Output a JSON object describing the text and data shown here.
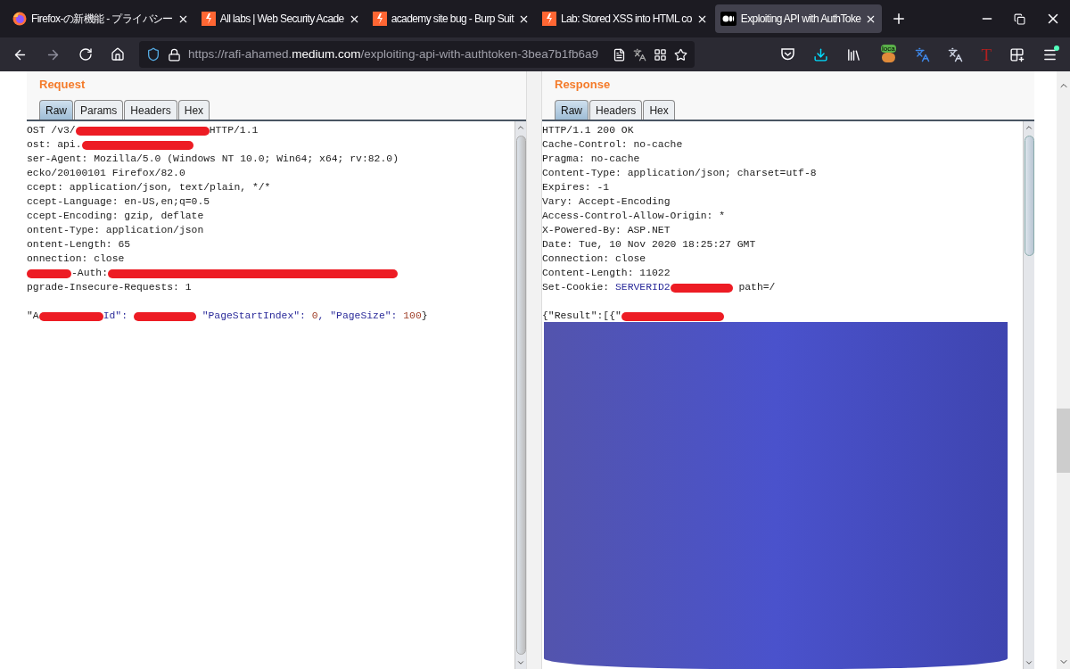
{
  "tabs": [
    {
      "title": "Firefox-の新機能 - プライバシー",
      "kind": "firefox",
      "selected": false
    },
    {
      "title": "All labs | Web Security Acade",
      "kind": "burp",
      "selected": false
    },
    {
      "title": "academy site bug - Burp Suit",
      "kind": "burp",
      "selected": false
    },
    {
      "title": "Lab: Stored XSS into HTML co",
      "kind": "burp",
      "selected": false
    },
    {
      "title": "Exploiting API with AuthToke",
      "kind": "medium",
      "selected": true
    }
  ],
  "url": {
    "before": "https://rafi-ahamed.",
    "domain": "medium.com",
    "after": "/exploiting-api-with-authtoken-3bea7b1fb6a9"
  },
  "extensions": {
    "badge": "loca",
    "letter": "T"
  },
  "request": {
    "title": "Request",
    "tabs": [
      {
        "label": "Raw",
        "selected": true
      },
      {
        "label": "Params",
        "selected": false
      },
      {
        "label": "Headers",
        "selected": false
      },
      {
        "label": "Hex",
        "selected": false
      }
    ],
    "lines": [
      [
        {
          "kind": "text",
          "text": "OST /v3/"
        },
        {
          "kind": "redaction"
        },
        {
          "kind": "text",
          "text": "HTTP/1.1"
        }
      ],
      [
        {
          "kind": "text",
          "text": "ost: api."
        },
        {
          "kind": "redaction"
        }
      ],
      [
        {
          "kind": "text",
          "text": "ser-Agent: Mozilla/5.0 (Windows NT 10.0; Win64; x64; rv:82.0)"
        }
      ],
      [
        {
          "kind": "text",
          "text": "ecko/20100101 Firefox/82.0"
        }
      ],
      [
        {
          "kind": "text",
          "text": "ccept: application/json, text/plain, */*"
        }
      ],
      [
        {
          "kind": "text",
          "text": "ccept-Language: en-US,en;q=0.5"
        }
      ],
      [
        {
          "kind": "text",
          "text": "ccept-Encoding: gzip, deflate"
        }
      ],
      [
        {
          "kind": "text",
          "text": "ontent-Type: application/json"
        }
      ],
      [
        {
          "kind": "text",
          "text": "ontent-Length: 65"
        }
      ],
      [
        {
          "kind": "text",
          "text": "onnection: close"
        }
      ],
      [
        {
          "kind": "redaction"
        },
        {
          "kind": "text",
          "text": "-Auth:"
        },
        {
          "kind": "redaction"
        }
      ],
      [
        {
          "kind": "text",
          "text": "pgrade-Insecure-Requests: 1"
        }
      ]
    ],
    "body": [
      [
        {
          "kind": "text",
          "text": "\"A"
        },
        {
          "kind": "redaction"
        },
        {
          "kind": "key",
          "text": "Id\": "
        },
        {
          "kind": "redaction"
        },
        {
          "kind": "key",
          "text": " \"PageStartIndex\":"
        },
        {
          "kind": "number",
          "text": " 0"
        },
        {
          "kind": "key",
          "text": ", \"PageSize\":"
        },
        {
          "kind": "number",
          "text": " 100"
        },
        {
          "kind": "text",
          "text": "}"
        }
      ]
    ]
  },
  "response": {
    "title": "Response",
    "tabs": [
      {
        "label": "Raw",
        "selected": true
      },
      {
        "label": "Headers",
        "selected": false
      },
      {
        "label": "Hex",
        "selected": false
      }
    ],
    "lines": [
      [
        {
          "kind": "text",
          "text": "HTTP/1.1 200 OK"
        }
      ],
      [
        {
          "kind": "text",
          "text": "Cache-Control: no-cache"
        }
      ],
      [
        {
          "kind": "text",
          "text": "Pragma: no-cache"
        }
      ],
      [
        {
          "kind": "text",
          "text": "Content-Type: application/json; charset=utf-8"
        }
      ],
      [
        {
          "kind": "text",
          "text": "Expires: -1"
        }
      ],
      [
        {
          "kind": "text",
          "text": "Vary: Accept-Encoding"
        }
      ],
      [
        {
          "kind": "text",
          "text": "Access-Control-Allow-Origin: *"
        }
      ],
      [
        {
          "kind": "text",
          "text": "X-Powered-By: ASP.NET"
        }
      ],
      [
        {
          "kind": "text",
          "text": "Date: Tue, 10 Nov 2020 18:25:27 GMT"
        }
      ],
      [
        {
          "kind": "text",
          "text": "Connection: close"
        }
      ],
      [
        {
          "kind": "text",
          "text": "Content-Length: 11022"
        }
      ],
      [
        {
          "kind": "text",
          "text": "Set-Cookie: "
        },
        {
          "kind": "key",
          "text": "SERVERID2"
        },
        {
          "kind": "redaction"
        },
        {
          "kind": "text",
          "text": " path=/"
        }
      ]
    ],
    "body": [
      [
        {
          "kind": "text",
          "text": "{\"Result\":[{\""
        },
        {
          "kind": "redaction"
        }
      ]
    ]
  }
}
